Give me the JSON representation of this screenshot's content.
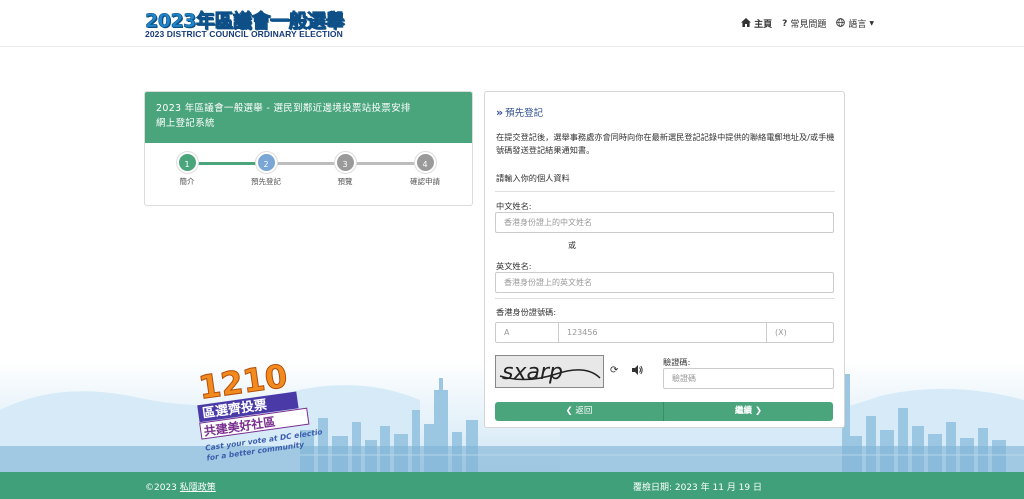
{
  "header": {
    "logo_title": "2023年區議會一般選舉",
    "logo_subtitle": "2023 DISTRICT COUNCIL ORDINARY ELECTION",
    "nav": [
      {
        "label": "主頁",
        "icon": "home-icon"
      },
      {
        "label": "常見問題",
        "icon": "question-icon"
      },
      {
        "label": "語言",
        "icon": "globe-icon"
      }
    ]
  },
  "left_panel": {
    "title_line1": "2023 年區議會一般選舉 - 選民到鄰近邊境投票站投票安排",
    "title_line2": "網上登記系統",
    "steps": [
      {
        "number": "1",
        "label": "簡介",
        "state": "done"
      },
      {
        "number": "2",
        "label": "預先登記",
        "state": "active"
      },
      {
        "number": "3",
        "label": "預覽",
        "state": "pending"
      },
      {
        "number": "4",
        "label": "確認申請",
        "state": "pending"
      }
    ]
  },
  "form": {
    "heading": "預先登記",
    "intro": "在提交登記後，選舉事務處亦會同時向你在最新選民登記記錄中提供的聯絡電郵地址及/或手機號碼發送登記結果通知書。",
    "section_label": "請輸入你的個人資料",
    "chinese_name": {
      "label": "中文姓名:",
      "placeholder": "香港身份證上的中文姓名"
    },
    "or_text": "或",
    "english_name": {
      "label": "英文姓名:",
      "placeholder": "香港身份證上的英文姓名"
    },
    "hkid": {
      "label": "香港身份證號碼:",
      "prefix_placeholder": "A",
      "number_placeholder": "123456",
      "check_placeholder": "(X)"
    },
    "captcha": {
      "image_text": "sxarp",
      "label": "驗證碼:",
      "placeholder": "驗證碼"
    },
    "back_button": "返回",
    "next_button": "繼續"
  },
  "promo": {
    "number": "1210",
    "line1": "區選齊投票",
    "line2": "共建美好社區",
    "line3": "Cast your vote at DC election",
    "line4": "for a better community"
  },
  "footer": {
    "copyright": "©2023",
    "privacy_link": "私隱政策",
    "revised_date": "覆檢日期: 2023 年 11 月 19 日"
  },
  "colors": {
    "primary_green": "#4aa57d",
    "step_active": "#7aa6d6",
    "step_pending": "#9a9a9a",
    "footer_green": "#3fa07a"
  }
}
